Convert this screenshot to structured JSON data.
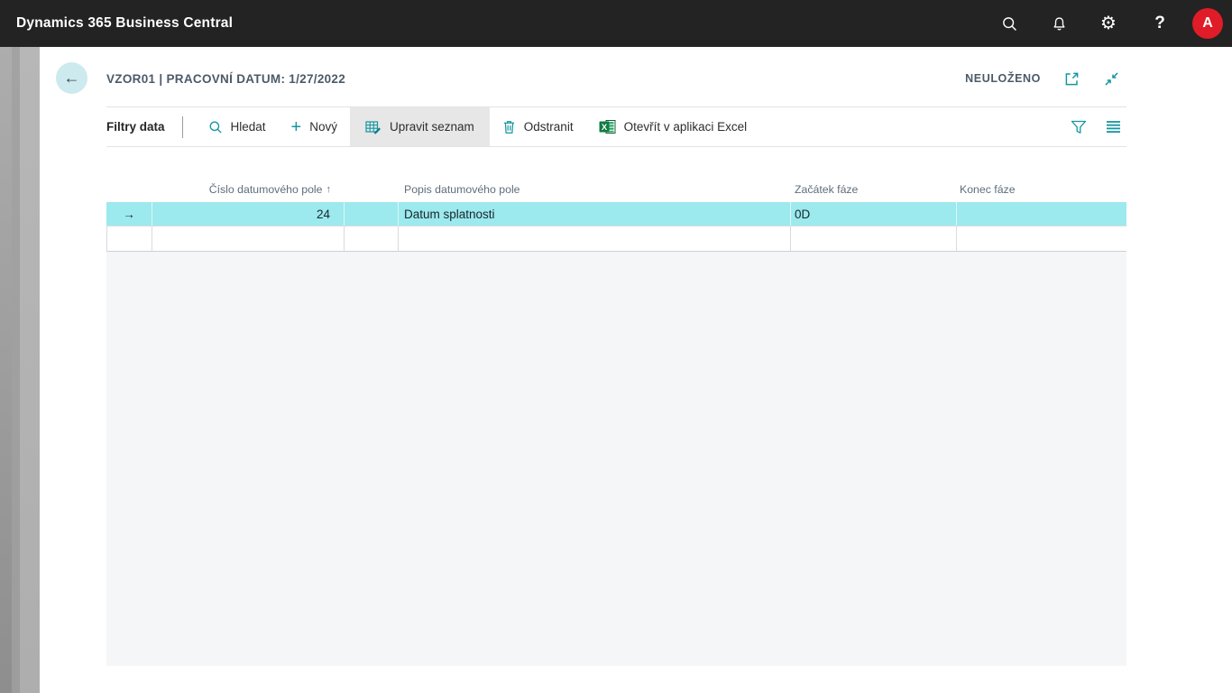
{
  "topbar": {
    "title": "Dynamics 365 Business Central",
    "avatar_initial": "A"
  },
  "page_header": {
    "title": "VZOR01 | PRACOVNÍ DATUM: 1/27/2022",
    "save_status": "NEULOŽENO"
  },
  "toolbar": {
    "filters_label": "Filtry data",
    "actions": {
      "search": "Hledat",
      "new": "Nový",
      "edit_list": "Upravit seznam",
      "delete": "Odstranit",
      "open_in_excel": "Otevřít v aplikaci Excel"
    }
  },
  "table": {
    "headers": {
      "number": "Číslo datumového pole",
      "description": "Popis datumového pole",
      "phase_start": "Začátek fáze",
      "phase_end": "Konec fáze"
    },
    "sort_indicator": "↑",
    "rows": [
      {
        "number": "24",
        "description": "Datum splatnosti",
        "phase_start": "0D",
        "phase_end": ""
      }
    ]
  },
  "icons": {
    "row_marker": "→",
    "back_arrow": "←",
    "gear": "⚙",
    "help": "?",
    "plus": "+"
  },
  "colors": {
    "topbar_bg": "#232323",
    "accent_teal": "#1496a0",
    "selected_row_cyan": "#9ce9ee",
    "avatar_red": "#df1c27",
    "excel_green": "#107c41",
    "header_text": "#4c5a68"
  }
}
